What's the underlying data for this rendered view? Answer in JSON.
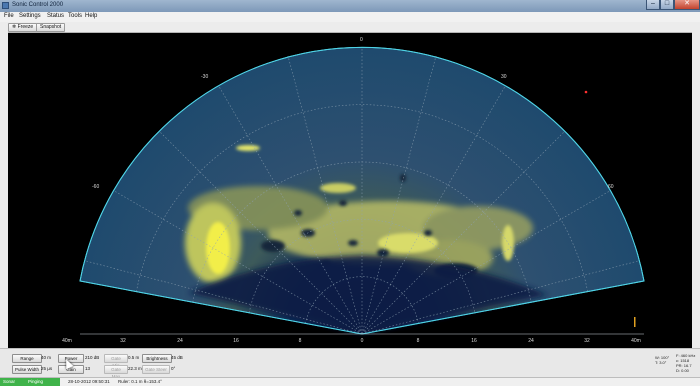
{
  "window": {
    "title": "Sonic Control 2000",
    "min": "–",
    "max": "□",
    "close": "✕"
  },
  "menu": [
    "File",
    "Settings",
    "Status",
    "Tools",
    "Help"
  ],
  "toolbar": {
    "freeze": "Freeze",
    "snapshot": "Snapshot"
  },
  "sonar": {
    "bearing_labels": {
      "center": "0",
      "left30": "-30",
      "right30": "30",
      "left60": "-60",
      "right60": "60"
    },
    "range_labels": [
      "40m",
      "32",
      "24",
      "16",
      "8",
      "0",
      "8",
      "16",
      "24",
      "32",
      "40m"
    ],
    "colors": {
      "fan_edge": "#4fd3e6",
      "grid": "#8fa3b3",
      "echo": "#e6e86a",
      "water": "#14314d"
    }
  },
  "controls": {
    "range": {
      "label": "Range",
      "value": "40 m"
    },
    "power": {
      "label": "Power",
      "value": "210 dB"
    },
    "gate_min": {
      "label": "Gate Min",
      "value": "0.5 m"
    },
    "brightness": {
      "label": "Brightness",
      "value": "45 dB"
    },
    "pulse_width": {
      "label": "Pulse Width",
      "value": "25 µs"
    },
    "gain": {
      "label": "Gain",
      "value": "13"
    },
    "gate_max": {
      "label": "Gate Max",
      "value": "22.3 m"
    },
    "gate_steer": {
      "label": "Gate Steer",
      "value": "0°"
    }
  },
  "readout": {
    "lines_left": [
      "W: 100°",
      "T: 3.0°"
    ],
    "lines_right": [
      "F: 460 kHz",
      "c: 1518",
      "PR: 16.7",
      "D: 0.00"
    ]
  },
  "status": {
    "connection": "Sonar",
    "sync": "Pinging",
    "datetime": "28-10-2012 09:50:31",
    "ruler": "Ruler: 0.1 m  θ=153.4°"
  }
}
